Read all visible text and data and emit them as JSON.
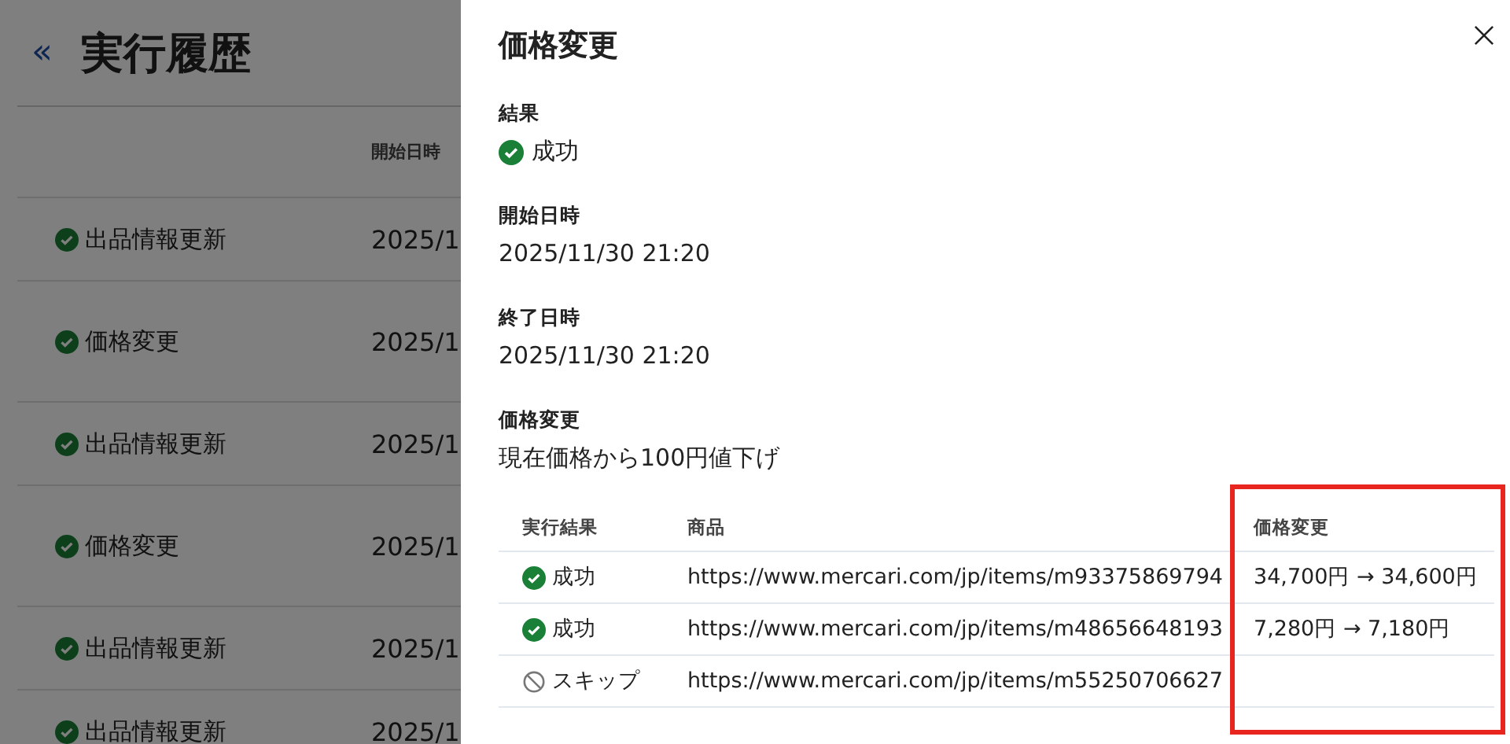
{
  "page": {
    "back_icon": "«",
    "title": "実行履歴",
    "columns": [
      "開始日時"
    ],
    "rows": [
      {
        "kind": "success",
        "task": "出品情報更新",
        "started": "2025/1"
      },
      {
        "kind": "success",
        "task": "価格変更",
        "started": "2025/1"
      },
      {
        "kind": "success",
        "task": "出品情報更新",
        "started": "2025/1"
      },
      {
        "kind": "success",
        "task": "価格変更",
        "started": "2025/1"
      },
      {
        "kind": "success",
        "task": "出品情報更新",
        "started": "2025/1"
      },
      {
        "kind": "success",
        "task": "出品情報更新",
        "started": "2025/1"
      }
    ]
  },
  "drawer": {
    "title": "価格変更",
    "fields": [
      {
        "label": "結果",
        "value": "成功",
        "kind": "success"
      },
      {
        "label": "開始日時",
        "value": "2025/11/30 21:20"
      },
      {
        "label": "終了日時",
        "value": "2025/11/30 21:20"
      },
      {
        "label": "価格変更",
        "value": "現在価格から100円値下げ"
      }
    ],
    "table": {
      "columns": [
        {
          "label": "実行結果",
          "highlighted": false
        },
        {
          "label": "商品",
          "highlighted": false
        },
        {
          "label": "価格変更",
          "highlighted": true
        }
      ],
      "rows": [
        {
          "kind": "success",
          "result": "成功",
          "item": "https://www.mercari.com/jp/items/m93375869794",
          "price_change": "34,700円 → 34,600円"
        },
        {
          "kind": "success",
          "result": "成功",
          "item": "https://www.mercari.com/jp/items/m48656648193",
          "price_change": "7,280円 → 7,180円"
        },
        {
          "kind": "skipped",
          "result": "スキップ",
          "item": "https://www.mercari.com/jp/items/m55250706627"
        }
      ]
    }
  }
}
